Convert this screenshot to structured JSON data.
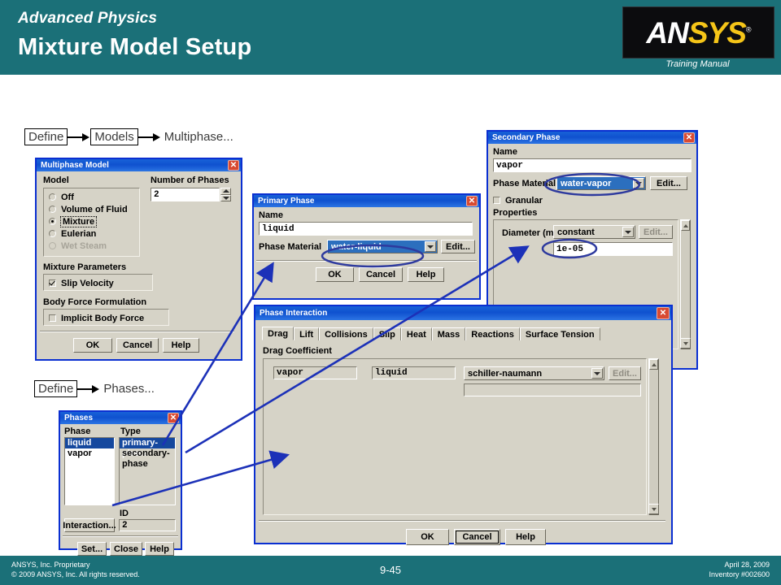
{
  "header": {
    "subtitle": "Advanced Physics",
    "title": "Mixture Model Setup",
    "logo_an": "AN",
    "logo_sys": "SYS",
    "logo_reg": "®",
    "training_manual": "Training Manual",
    "brand_teal": "#1b7078",
    "logo_gold": "#f5c518"
  },
  "footer": {
    "left_line1": "ANSYS, Inc. Proprietary",
    "left_line2": "© 2009 ANSYS, Inc.  All rights reserved.",
    "page": "9-45",
    "right_line1": "April 28, 2009",
    "right_line2": "Inventory #002600"
  },
  "menu_paths": {
    "models_path": {
      "item1": "Define",
      "item2": "Models",
      "item3": "Multiphase..."
    },
    "phases_path": {
      "item1": "Define",
      "item2": "Phases..."
    }
  },
  "multiphase_model": {
    "title": "Multiphase Model",
    "close": "✕",
    "model_label": "Model",
    "options": [
      {
        "label": "Off",
        "selected": false,
        "disabled": false
      },
      {
        "label": "Volume of Fluid",
        "selected": false,
        "disabled": false
      },
      {
        "label": "Mixture",
        "selected": true,
        "disabled": false
      },
      {
        "label": "Eulerian",
        "selected": false,
        "disabled": false
      },
      {
        "label": "Wet Steam",
        "selected": false,
        "disabled": true
      }
    ],
    "number_of_phases_label": "Number of Phases",
    "number_of_phases_value": "2",
    "mixture_parameters_label": "Mixture Parameters",
    "slip_velocity_label": "Slip Velocity",
    "slip_velocity_checked": true,
    "body_force_label": "Body Force Formulation",
    "implicit_body_force_label": "Implicit Body Force",
    "implicit_body_force_checked": false,
    "buttons": {
      "ok": "OK",
      "cancel": "Cancel",
      "help": "Help"
    }
  },
  "primary_phase": {
    "title": "Primary Phase",
    "close": "✕",
    "name_label": "Name",
    "name_value": "liquid",
    "phase_material_label": "Phase Material",
    "phase_material_value": "water-liquid",
    "edit_label": "Edit...",
    "buttons": {
      "ok": "OK",
      "cancel": "Cancel",
      "help": "Help"
    }
  },
  "secondary_phase": {
    "title": "Secondary Phase",
    "close": "✕",
    "name_label": "Name",
    "name_value": "vapor",
    "phase_material_label": "Phase Material",
    "phase_material_value": "water-vapor",
    "edit_label": "Edit...",
    "granular_label": "Granular",
    "granular_checked": false,
    "properties_label": "Properties",
    "diameter_label": "Diameter (m)",
    "diameter_method": "constant",
    "diameter_edit_label": "Edit...",
    "diameter_value": "1e-05"
  },
  "phases": {
    "title": "Phases",
    "close": "✕",
    "col_phase": "Phase",
    "col_type": "Type",
    "phase_rows": [
      {
        "phase": "liquid",
        "type": "primary-phase",
        "selected": true
      },
      {
        "phase": "vapor",
        "type": "secondary-phase",
        "selected": false
      }
    ],
    "id_label": "ID",
    "id_value": "2",
    "interaction_label": "Interaction...",
    "buttons": {
      "set": "Set...",
      "close": "Close",
      "help": "Help"
    }
  },
  "phase_interaction": {
    "title": "Phase Interaction",
    "close": "✕",
    "tabs": [
      {
        "label": "Drag",
        "active": true
      },
      {
        "label": "Lift",
        "active": false
      },
      {
        "label": "Collisions",
        "active": false
      },
      {
        "label": "Slip",
        "active": false
      },
      {
        "label": "Heat",
        "active": false
      },
      {
        "label": "Mass",
        "active": false
      },
      {
        "label": "Reactions",
        "active": false
      },
      {
        "label": "Surface Tension",
        "active": false
      }
    ],
    "drag_coefficient_label": "Drag Coefficient",
    "phase_a": "vapor",
    "phase_b": "liquid",
    "drag_law": "schiller-naumann",
    "edit_label": "Edit...",
    "buttons": {
      "ok": "OK",
      "cancel": "Cancel",
      "help": "Help"
    }
  },
  "annotations": {
    "highlight_color": "#2e3a9e",
    "arrow_color": "#0a2fd1",
    "ellipse_targets": [
      "water-liquid",
      "water-vapor",
      "1e-05"
    ],
    "arrow_count": 3
  }
}
